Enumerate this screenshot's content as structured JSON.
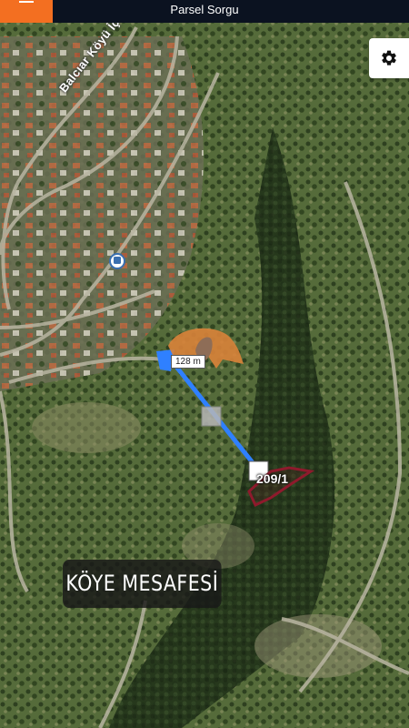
{
  "header": {
    "title": "Parsel Sorgu",
    "menu_icon": "hamburger-icon"
  },
  "map": {
    "road_label": "Balcıar Köyü İç Yolu",
    "distance_label": "128 m",
    "parcel_label": "209/1",
    "caption": "KÖYE MESAFESİ",
    "colors": {
      "measure_line": "#2f80ff",
      "parcel_outline": "#8e1a2c",
      "header_bg": "#0b1220",
      "menu_bg": "#f36f21"
    },
    "icons": [
      "bus-stop-icon",
      "location-marker-icon",
      "gear-icon"
    ]
  }
}
